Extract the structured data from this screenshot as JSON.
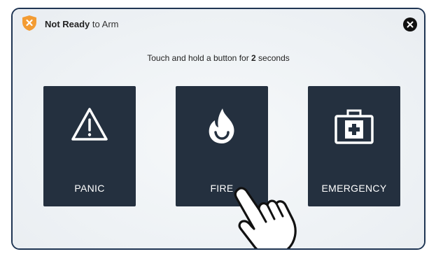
{
  "header": {
    "status_bold": "Not Ready",
    "status_rest": " to Arm"
  },
  "instruction": {
    "prefix": "Touch and hold a button for ",
    "seconds": "2",
    "suffix": " seconds"
  },
  "buttons": [
    {
      "label": "PANIC",
      "icon": "warning-icon"
    },
    {
      "label": "FIRE",
      "icon": "fire-icon"
    },
    {
      "label": "EMERGENCY",
      "icon": "first-aid-kit-icon"
    }
  ],
  "colors": {
    "accent": "#f39c33",
    "button_bg": "#24303f",
    "border": "#1f3553"
  }
}
